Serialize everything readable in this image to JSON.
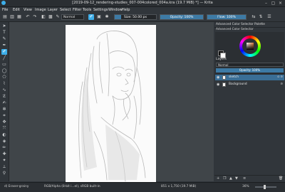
{
  "window": {
    "title": "[2019-09-12_rendering-studies_007-004colored_004a.kra (19.7 MiB) *] — Krita"
  },
  "menu": [
    "File",
    "Edit",
    "View",
    "Image",
    "Layer",
    "Select",
    "Filter",
    "Tools",
    "Settings",
    "Window",
    "Help"
  ],
  "toolbar": {
    "blend_mode": "Normal",
    "size_label": "Size: 50.00 px",
    "size_fraction": 0.15,
    "opacity_label": "Opacity: 100%",
    "opacity_fraction": 1.0,
    "flow_label": "Flow: 100%",
    "flow_fraction": 1.0
  },
  "dockers": {
    "tab1": "Advanced Color Selector",
    "tab2": "Palette",
    "color_selector_title": "Advanced Color Selector",
    "layers_title": "Layers",
    "blend": "Normal",
    "opacity": "Opacity: 100%",
    "layers": [
      {
        "name": "sketch",
        "selected": true
      },
      {
        "name": "Background",
        "selected": false
      }
    ]
  },
  "status": {
    "brush": "d) Eraser-grainy",
    "color": "RGB/Alpha (8-bit i...el), sRGB built-in",
    "dimensions": "851 x 1,750 (19.7 MiB)",
    "zoom": "36%"
  }
}
